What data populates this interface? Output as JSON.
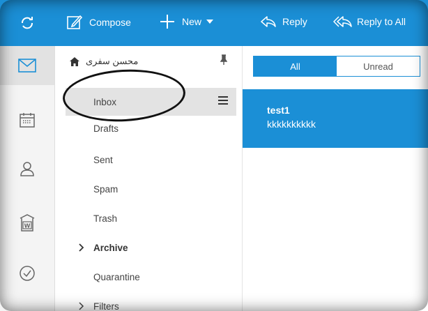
{
  "toolbar": {
    "compose_label": "Compose",
    "new_label": "New",
    "reply_label": "Reply",
    "reply_all_label": "Reply to All"
  },
  "rail": {
    "items": [
      {
        "icon": "mail-icon",
        "active": true
      },
      {
        "icon": "calendar-icon"
      },
      {
        "icon": "contacts-icon"
      },
      {
        "icon": "document-icon"
      },
      {
        "icon": "tasks-icon"
      }
    ]
  },
  "folders": {
    "account_name": "محسن سفری",
    "items": [
      {
        "label": "Inbox",
        "selected": true
      },
      {
        "label": "Drafts"
      },
      {
        "label": "Sent"
      },
      {
        "label": "Spam"
      },
      {
        "label": "Trash"
      },
      {
        "label": "Archive",
        "bold": true,
        "expandable": true
      },
      {
        "label": "Quarantine"
      },
      {
        "label": "Filters",
        "expandable": true
      }
    ]
  },
  "list": {
    "filter_all": "All",
    "filter_unread": "Unread",
    "messages": [
      {
        "subject": "test1",
        "preview": "kkkkkkkkkk"
      }
    ]
  },
  "colors": {
    "accent": "#1b8fd6",
    "selected_folder": "#e3e3e3"
  }
}
